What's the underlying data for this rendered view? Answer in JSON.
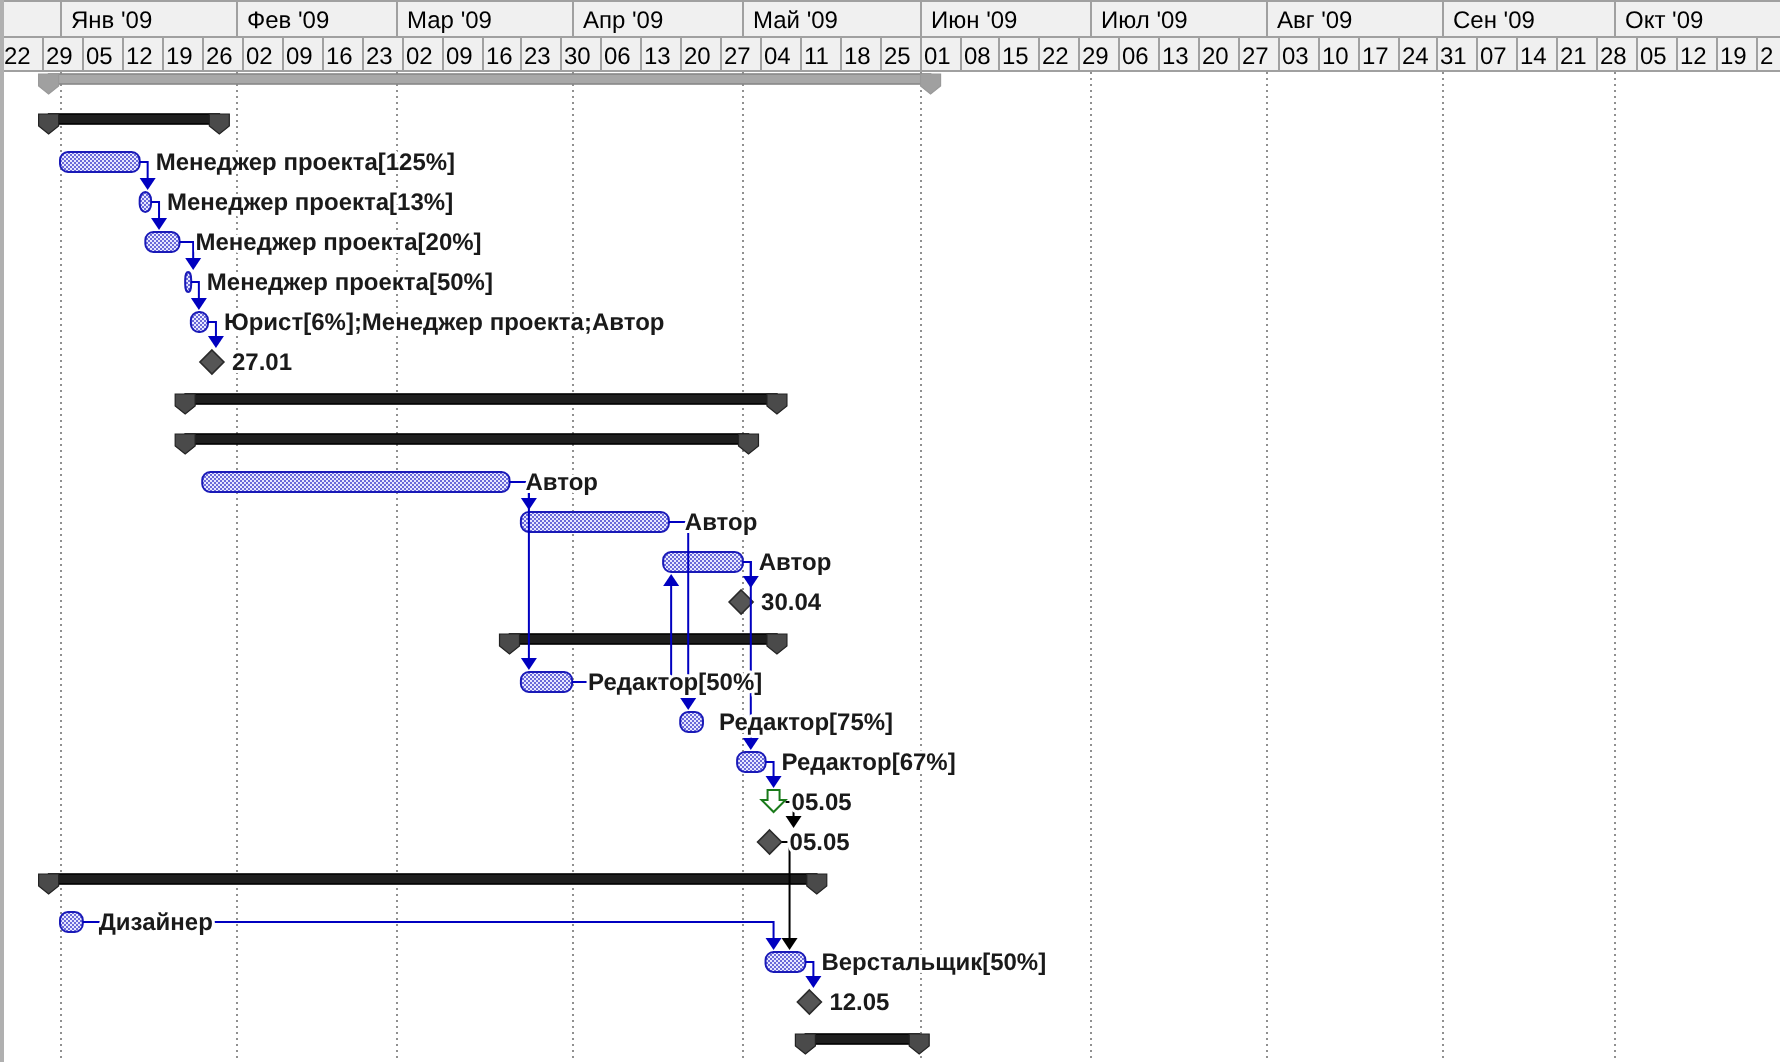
{
  "timescale": {
    "months": [
      "Янв '09",
      "Фев '09",
      "Мар '09",
      "Апр '09",
      "Май '09",
      "Июн '09",
      "Июл '09",
      "Авг '09",
      "Сен '09",
      "Окт '09"
    ],
    "weeks": [
      "22",
      "29",
      "05",
      "12",
      "19",
      "26",
      "02",
      "09",
      "16",
      "23",
      "02",
      "09",
      "16",
      "23",
      "30",
      "06",
      "13",
      "20",
      "27",
      "04",
      "11",
      "18",
      "25",
      "01",
      "08",
      "15",
      "22",
      "29",
      "06",
      "13",
      "20",
      "27",
      "03",
      "10",
      "17",
      "24",
      "31",
      "07",
      "14",
      "21",
      "28",
      "05",
      "12",
      "19",
      "2"
    ]
  },
  "rows": [
    {
      "kind": "project_summary"
    },
    {
      "kind": "summary"
    },
    {
      "kind": "task",
      "label": "Менеджер проекта[125%]"
    },
    {
      "kind": "task",
      "label": "Менеджер проекта[13%]"
    },
    {
      "kind": "task",
      "label": "Менеджер проекта[20%]"
    },
    {
      "kind": "task",
      "label": "Менеджер проекта[50%]"
    },
    {
      "kind": "task",
      "label": "Юрист[6%];Менеджер проекта;Автор"
    },
    {
      "kind": "milestone",
      "label": "27.01"
    },
    {
      "kind": "summary"
    },
    {
      "kind": "summary"
    },
    {
      "kind": "task",
      "label": "Автор"
    },
    {
      "kind": "task",
      "label": "Автор"
    },
    {
      "kind": "task",
      "label": "Автор"
    },
    {
      "kind": "milestone",
      "label": "30.04"
    },
    {
      "kind": "summary"
    },
    {
      "kind": "task",
      "label": "Редактор[50%]"
    },
    {
      "kind": "task",
      "label": "Редактор[75%]"
    },
    {
      "kind": "task",
      "label": "Редактор[67%]"
    },
    {
      "kind": "deadline",
      "label": "05.05"
    },
    {
      "kind": "milestone",
      "label": "05.05"
    },
    {
      "kind": "summary"
    },
    {
      "kind": "task",
      "label": "Дизайнер"
    },
    {
      "kind": "task",
      "label": "Верстальщик[50%]"
    },
    {
      "kind": "milestone",
      "label": "12.05"
    },
    {
      "kind": "summary"
    }
  ]
}
